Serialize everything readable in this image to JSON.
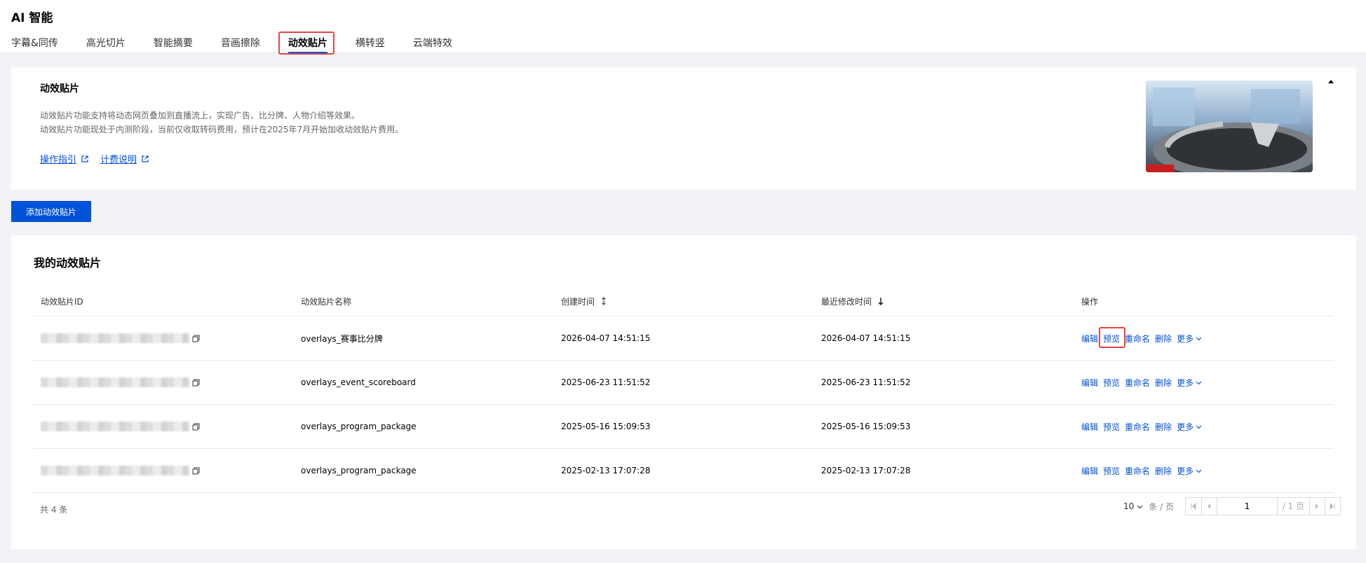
{
  "app": {
    "title": "AI 智能"
  },
  "tabs": [
    {
      "label": "字幕&同传"
    },
    {
      "label": "高光切片"
    },
    {
      "label": "智能摘要"
    },
    {
      "label": "音画擦除"
    },
    {
      "label": "动效贴片",
      "active": true
    },
    {
      "label": "横转竖"
    },
    {
      "label": "云端特效"
    }
  ],
  "intro": {
    "title": "动效贴片",
    "desc_line1": "动效贴片功能支持将动态网页叠加到直播流上，实现广告、比分牌、人物介绍等效果。",
    "desc_line2": "动效贴片功能现处于内测阶段，当前仅收取转码费用，预计在2025年7月开始加收动效贴片费用。",
    "link_guide": "操作指引",
    "link_billing": "计费说明"
  },
  "add_button": "添加动效贴片",
  "list": {
    "title": "我的动效贴片",
    "columns": {
      "id": "动效贴片ID",
      "name": "动效贴片名称",
      "created": "创建时间",
      "modified": "最近修改时间",
      "ops": "操作"
    },
    "rows": [
      {
        "name": "overlays_赛事比分牌",
        "created": "2026-04-07 14:51:15",
        "modified": "2026-04-07 14:51:15"
      },
      {
        "name": "overlays_event_scoreboard",
        "created": "2025-06-23 11:51:52",
        "modified": "2025-06-23 11:51:52"
      },
      {
        "name": "overlays_program_package",
        "created": "2025-05-16 15:09:53",
        "modified": "2025-05-16 15:09:53"
      },
      {
        "name": "overlays_program_package",
        "created": "2025-02-13 17:07:28",
        "modified": "2025-02-13 17:07:28"
      }
    ],
    "ops": {
      "edit": "编辑",
      "preview": "预览",
      "rename": "重命名",
      "delete": "删除",
      "more": "更多"
    }
  },
  "pagination": {
    "total": "共 4 条",
    "page_size": "10",
    "page_size_unit": "条 / 页",
    "current_page": "1",
    "total_pages": "/ 1 页"
  },
  "colors": {
    "accent": "#0052d9",
    "highlight": "#e54545"
  }
}
